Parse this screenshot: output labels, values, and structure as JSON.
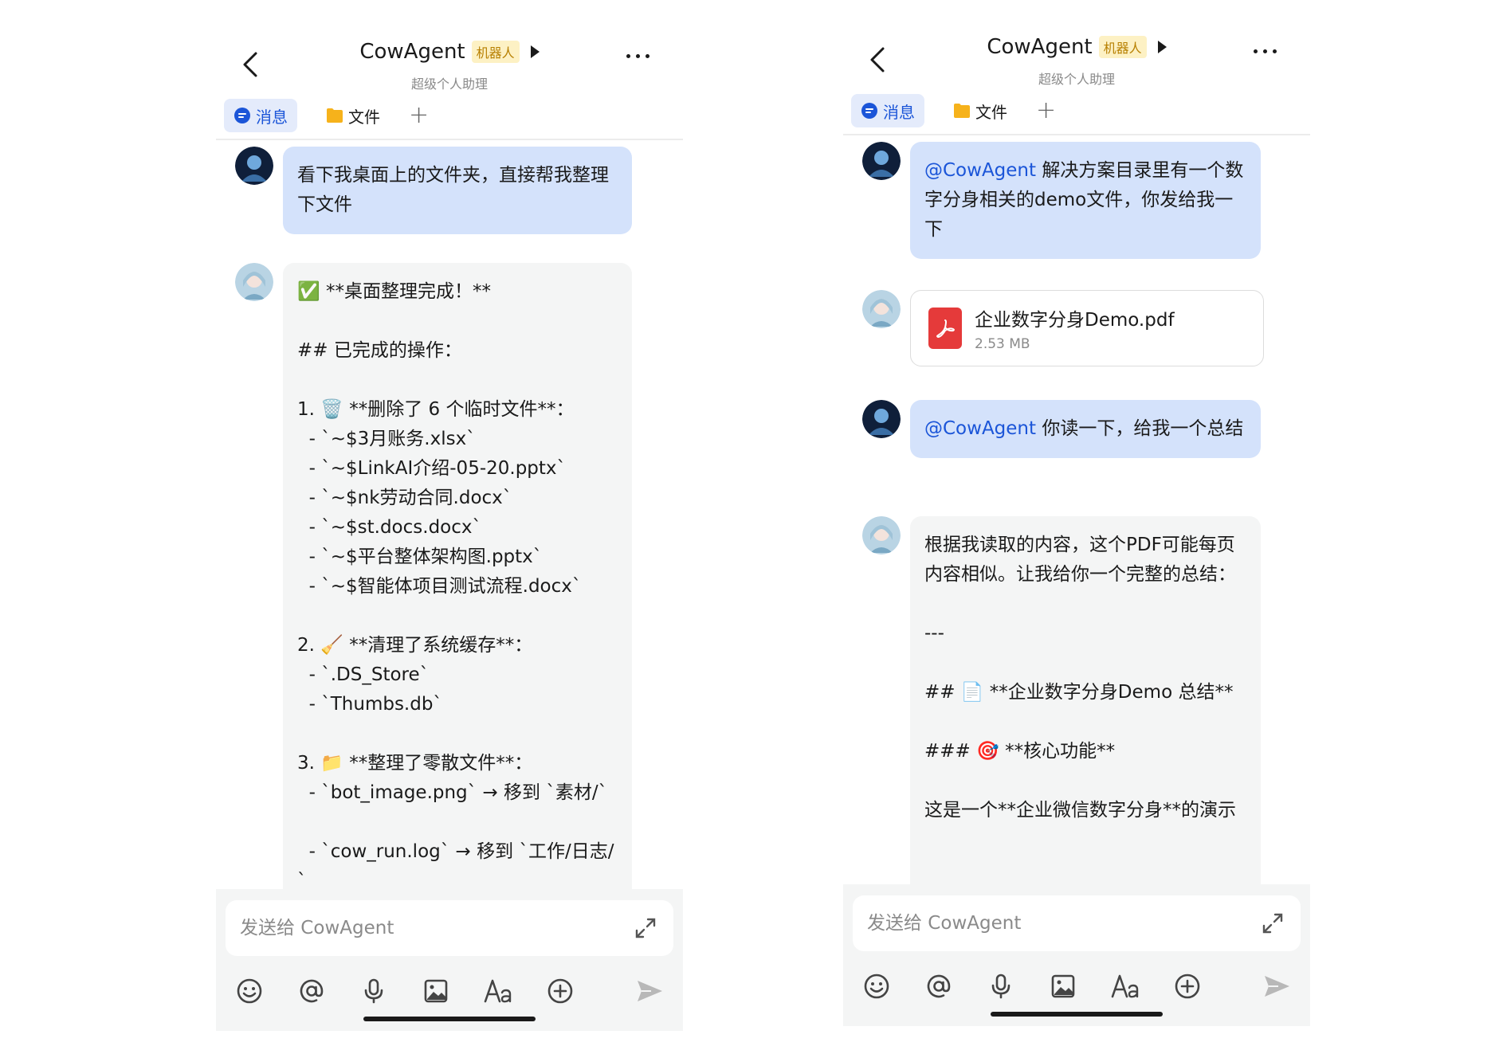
{
  "left": {
    "header": {
      "title": "CowAgent",
      "badge": "机器人",
      "subtitle": "超级个人助理"
    },
    "tabs": {
      "messages": "消息",
      "files": "文件"
    },
    "messages": [
      {
        "role": "user",
        "text": "看下我桌面上的文件夹，直接帮我整理下文件"
      },
      {
        "role": "bot",
        "text": "✅ **桌面整理完成！**\n\n## 已完成的操作：\n\n1. 🗑️ **删除了 6 个临时文件**：\n  - `~$3月账务.xlsx`\n  - `~$LinkAI介绍-05-20.pptx`\n  - `~$nk劳动合同.docx`\n  - `~$st.docs.docx`\n  - `~$平台整体架构图.pptx`\n  - `~$智能体项目测试流程.docx`\n\n2. 🧹 **清理了系统缓存**：\n  - `.DS_Store`\n  - `Thumbs.db`\n\n3. 📁 **整理了零散文件**：\n  - `bot_image.png` → 移到 `素材/`\n\n  - `cow_run.log` → 移到 `工作/日志/`"
      }
    ],
    "input": {
      "placeholder": "发送给 CowAgent"
    }
  },
  "right": {
    "header": {
      "title": "CowAgent",
      "badge": "机器人",
      "subtitle": "超级个人助理"
    },
    "tabs": {
      "messages": "消息",
      "files": "文件"
    },
    "messages": [
      {
        "role": "user",
        "mention": "@CowAgent",
        "text": " 解决方案目录里有一个数字分身相关的demo文件，你发给我一下"
      },
      {
        "role": "bot-file",
        "file_name": "企业数字分身Demo.pdf",
        "file_size": "2.53 MB"
      },
      {
        "role": "user",
        "mention": "@CowAgent",
        "text": " 你读一下，给我一个总结"
      },
      {
        "role": "bot",
        "text": "根据我读取的内容，这个PDF可能每页内容相似。让我给你一个完整的总结：\n\n---\n\n## 📄 **企业数字分身Demo 总结**\n\n### 🎯 **核心功能**\n\n这是一个**企业微信数字分身**的演示"
      }
    ],
    "input": {
      "placeholder": "发送给 CowAgent"
    }
  },
  "icons": {
    "back": "back-chevron-icon",
    "more": "more-dots-icon",
    "message_tab": "message-bubble-icon",
    "folder": "folder-icon",
    "plus": "plus-icon",
    "expand": "expand-icon",
    "emoji": "emoji-icon",
    "mention": "at-icon",
    "voice": "microphone-icon",
    "image": "image-icon",
    "text_format": "text-format-icon",
    "add": "add-circle-icon",
    "send": "send-icon",
    "pdf": "pdf-file-icon"
  },
  "colors": {
    "accent": "#1b55d8",
    "user_bubble": "#d4e2fb",
    "bot_bubble": "#f4f5f5",
    "badge": "#fdf1c4",
    "pdf": "#e53a3a"
  }
}
